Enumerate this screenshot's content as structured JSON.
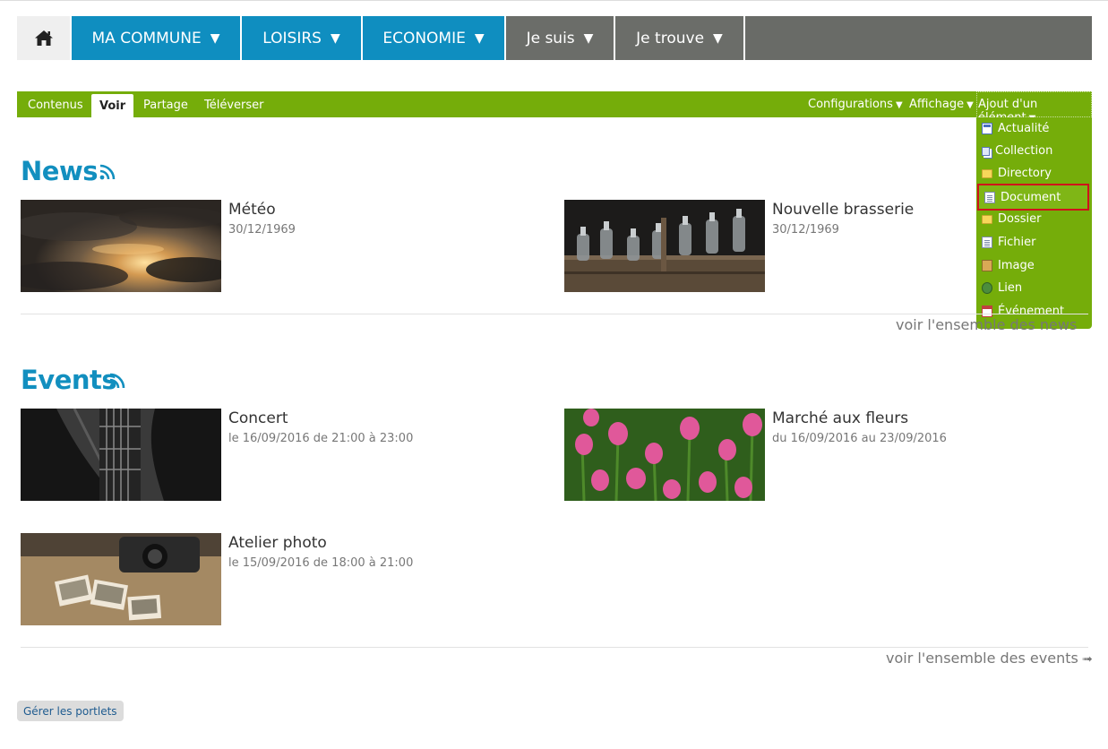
{
  "nav": {
    "home_icon": "home-icon",
    "items": [
      {
        "label": "MA COMMUNE",
        "caret": "▼"
      },
      {
        "label": "LOISIRS",
        "caret": "▼"
      },
      {
        "label": "ECONOMIE",
        "caret": "▼"
      },
      {
        "label": "Je suis",
        "caret": "▼"
      },
      {
        "label": "Je trouve",
        "caret": "▼"
      }
    ],
    "colors": {
      "blue": "#0f8ec0",
      "grey": "#6b6d69"
    }
  },
  "editbar": {
    "tabs": [
      "Contenus",
      "Voir",
      "Partage",
      "Téléverser"
    ],
    "active_tab": "Voir",
    "menus": [
      "Configurations",
      "Affichage",
      "Ajout d'un élément"
    ],
    "menu_arrow": "▼",
    "color": "#75ad0a"
  },
  "add_menu": {
    "items": [
      {
        "label": "Actualité",
        "icon": "news-icon"
      },
      {
        "label": "Collection",
        "icon": "collection-icon"
      },
      {
        "label": "Directory",
        "icon": "folder-icon"
      },
      {
        "label": "Document",
        "icon": "document-icon",
        "highlighted": true
      },
      {
        "label": "Dossier",
        "icon": "folder-icon"
      },
      {
        "label": "Fichier",
        "icon": "file-icon"
      },
      {
        "label": "Image",
        "icon": "image-icon"
      },
      {
        "label": "Lien",
        "icon": "link-icon"
      },
      {
        "label": "Événement",
        "icon": "event-icon"
      }
    ]
  },
  "news": {
    "title": "News",
    "items": [
      {
        "title": "Météo",
        "date": "30/12/1969"
      },
      {
        "title": "Nouvelle brasserie",
        "date": "30/12/1969"
      }
    ],
    "more": "voir l'ensemble des news"
  },
  "events": {
    "title": "Events",
    "items": [
      {
        "title": "Concert",
        "date": "le 16/09/2016 de 21:00 à 23:00"
      },
      {
        "title": "Marché aux fleurs",
        "date": "du 16/09/2016 au 23/09/2016"
      },
      {
        "title": "Atelier photo",
        "date": "le 15/09/2016 de 18:00 à 21:00"
      }
    ],
    "more": "voir l'ensemble des events",
    "more_arrow": "➟"
  },
  "footer": {
    "manage_portlets": "Gérer les portlets"
  }
}
